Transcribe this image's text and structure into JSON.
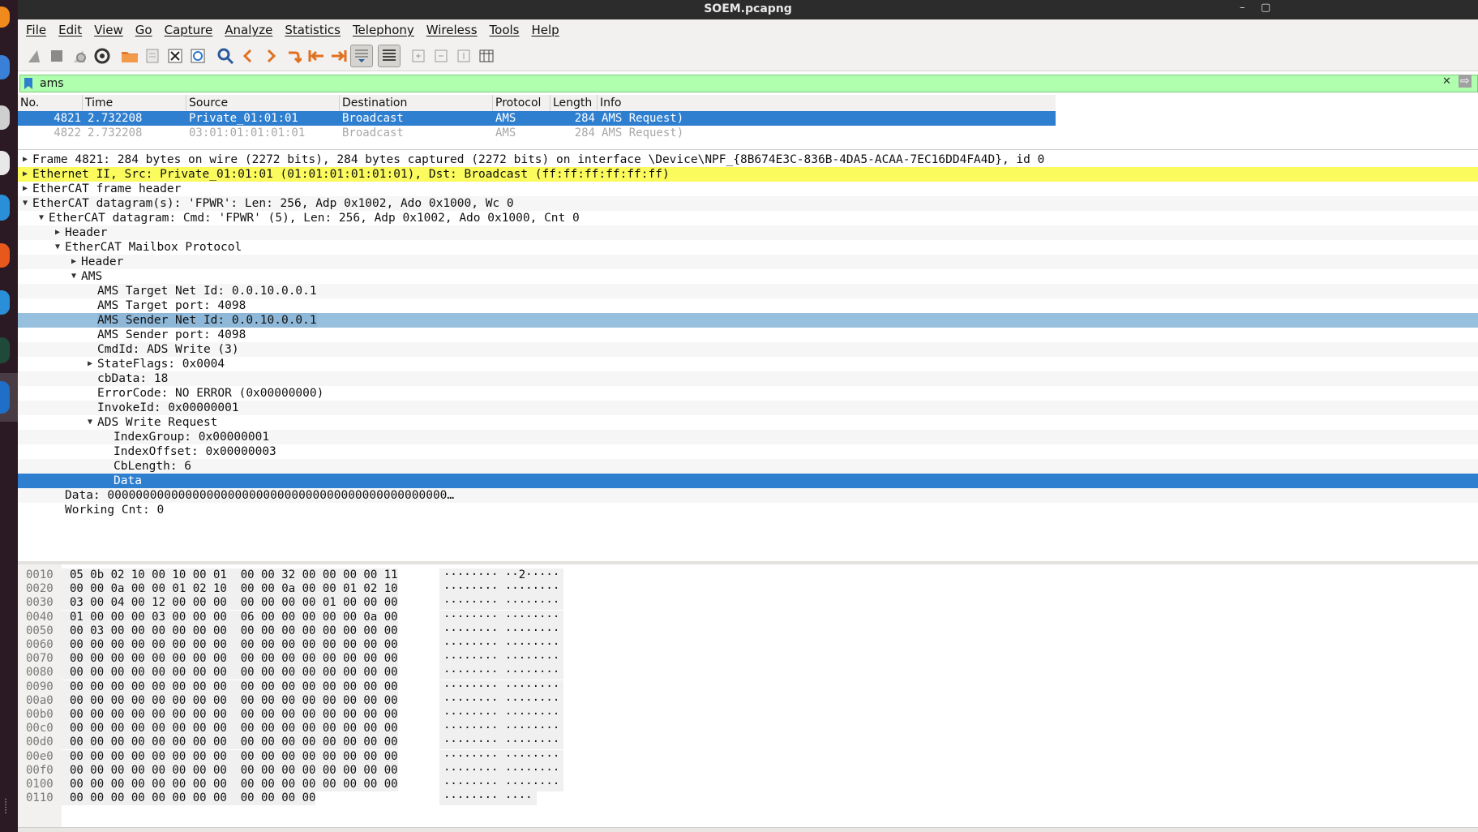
{
  "window": {
    "title": "SOEM.pcapng",
    "minimize": "–",
    "maximize": "▢"
  },
  "menu": [
    "File",
    "Edit",
    "View",
    "Go",
    "Capture",
    "Analyze",
    "Statistics",
    "Telephony",
    "Wireless",
    "Tools",
    "Help"
  ],
  "filter": {
    "value": "ams",
    "clear_glyph": "✕",
    "apply_glyph": "⇨"
  },
  "packet_list": {
    "columns": [
      "No.",
      "Time",
      "Source",
      "Destination",
      "Protocol",
      "Length",
      "Info"
    ],
    "rows": [
      {
        "no": "4821",
        "time": "2.732208",
        "source": "Private_01:01:01",
        "destination": "Broadcast",
        "protocol": "AMS",
        "length": "284",
        "info": "AMS Request)"
      },
      {
        "no": "4822",
        "time": "2.732208",
        "source": "03:01:01:01:01:01",
        "destination": "Broadcast",
        "protocol": "AMS",
        "length": "284",
        "info": "AMS Request)"
      }
    ]
  },
  "details": [
    {
      "indent": 0,
      "arrow": "right",
      "text": "Frame 4821: 284 bytes on wire (2272 bits), 284 bytes captured (2272 bits) on interface \\Device\\NPF_{8B674E3C-836B-4DA5-ACAA-7EC16DD4FA4D}, id 0"
    },
    {
      "indent": 0,
      "arrow": "right",
      "text": "Ethernet II, Src: Private_01:01:01 (01:01:01:01:01:01), Dst: Broadcast (ff:ff:ff:ff:ff:ff)"
    },
    {
      "indent": 0,
      "arrow": "right",
      "text": "EtherCAT frame header"
    },
    {
      "indent": 0,
      "arrow": "down",
      "text": "EtherCAT datagram(s): 'FPWR': Len: 256, Adp 0x1002, Ado 0x1000, Wc 0"
    },
    {
      "indent": 1,
      "arrow": "down",
      "text": "EtherCAT datagram: Cmd: 'FPWR' (5), Len: 256, Adp 0x1002, Ado 0x1000, Cnt 0"
    },
    {
      "indent": 2,
      "arrow": "right",
      "text": "Header"
    },
    {
      "indent": 2,
      "arrow": "down",
      "text": "EtherCAT Mailbox Protocol"
    },
    {
      "indent": 3,
      "arrow": "right",
      "text": "Header"
    },
    {
      "indent": 3,
      "arrow": "down",
      "text": "AMS"
    },
    {
      "indent": 4,
      "arrow": "",
      "text": "AMS Target Net Id: 0.0.10.0.0.1"
    },
    {
      "indent": 4,
      "arrow": "",
      "text": "AMS Target port: 4098"
    },
    {
      "indent": 4,
      "arrow": "",
      "text": "AMS Sender Net Id: 0.0.10.0.0.1"
    },
    {
      "indent": 4,
      "arrow": "",
      "text": "AMS Sender port: 4098"
    },
    {
      "indent": 4,
      "arrow": "",
      "text": "CmdId: ADS Write (3)"
    },
    {
      "indent": 4,
      "arrow": "right",
      "text": "StateFlags: 0x0004"
    },
    {
      "indent": 4,
      "arrow": "",
      "text": "cbData: 18"
    },
    {
      "indent": 4,
      "arrow": "",
      "text": "ErrorCode: NO ERROR (0x00000000)"
    },
    {
      "indent": 4,
      "arrow": "",
      "text": "InvokeId: 0x00000001"
    },
    {
      "indent": 4,
      "arrow": "down",
      "text": "ADS Write Request"
    },
    {
      "indent": 5,
      "arrow": "",
      "text": "IndexGroup: 0x00000001"
    },
    {
      "indent": 5,
      "arrow": "",
      "text": "IndexOffset: 0x00000003"
    },
    {
      "indent": 5,
      "arrow": "",
      "text": "CbLength: 6"
    },
    {
      "indent": 5,
      "arrow": "",
      "text": "Data"
    },
    {
      "indent": 2,
      "arrow": "",
      "text": "Data: 000000000000000000000000000000000000000000000000…"
    },
    {
      "indent": 2,
      "arrow": "",
      "text": "Working Cnt: 0"
    }
  ],
  "bytes": [
    {
      "offset": "0010",
      "hex": "05 0b 02 10 00 10 00 01  00 00 32 00 00 00 00 11",
      "ascii": "········ ··2·····"
    },
    {
      "offset": "0020",
      "hex": "00 00 0a 00 00 01 02 10  00 00 0a 00 00 01 02 10",
      "ascii": "········ ········"
    },
    {
      "offset": "0030",
      "hex": "03 00 04 00 12 00 00 00  00 00 00 00 01 00 00 00",
      "ascii": "········ ········"
    },
    {
      "offset": "0040",
      "hex": "01 00 00 00 03 00 00 00  06 00 00 00 00 00 0a 00",
      "ascii": "········ ········"
    },
    {
      "offset": "0050",
      "hex": "00 03 00 00 00 00 00 00  00 00 00 00 00 00 00 00",
      "ascii": "········ ········"
    },
    {
      "offset": "0060",
      "hex": "00 00 00 00 00 00 00 00  00 00 00 00 00 00 00 00",
      "ascii": "········ ········"
    },
    {
      "offset": "0070",
      "hex": "00 00 00 00 00 00 00 00  00 00 00 00 00 00 00 00",
      "ascii": "········ ········"
    },
    {
      "offset": "0080",
      "hex": "00 00 00 00 00 00 00 00  00 00 00 00 00 00 00 00",
      "ascii": "········ ········"
    },
    {
      "offset": "0090",
      "hex": "00 00 00 00 00 00 00 00  00 00 00 00 00 00 00 00",
      "ascii": "········ ········"
    },
    {
      "offset": "00a0",
      "hex": "00 00 00 00 00 00 00 00  00 00 00 00 00 00 00 00",
      "ascii": "········ ········"
    },
    {
      "offset": "00b0",
      "hex": "00 00 00 00 00 00 00 00  00 00 00 00 00 00 00 00",
      "ascii": "········ ········"
    },
    {
      "offset": "00c0",
      "hex": "00 00 00 00 00 00 00 00  00 00 00 00 00 00 00 00",
      "ascii": "········ ········"
    },
    {
      "offset": "00d0",
      "hex": "00 00 00 00 00 00 00 00  00 00 00 00 00 00 00 00",
      "ascii": "········ ········"
    },
    {
      "offset": "00e0",
      "hex": "00 00 00 00 00 00 00 00  00 00 00 00 00 00 00 00",
      "ascii": "········ ········"
    },
    {
      "offset": "00f0",
      "hex": "00 00 00 00 00 00 00 00  00 00 00 00 00 00 00 00",
      "ascii": "········ ········"
    },
    {
      "offset": "0100",
      "hex": "00 00 00 00 00 00 00 00  00 00 00 00 00 00 00 00",
      "ascii": "········ ········"
    },
    {
      "offset": "0110",
      "hex": "00 00 00 00 00 00 00 00  00 00 00 00",
      "ascii": "········ ····"
    }
  ],
  "colors": {
    "selection": "#2f7fd0",
    "field_highlight": "#96c0de",
    "warning_row": "#fbfb5e",
    "filter_ok": "#afffaf"
  }
}
